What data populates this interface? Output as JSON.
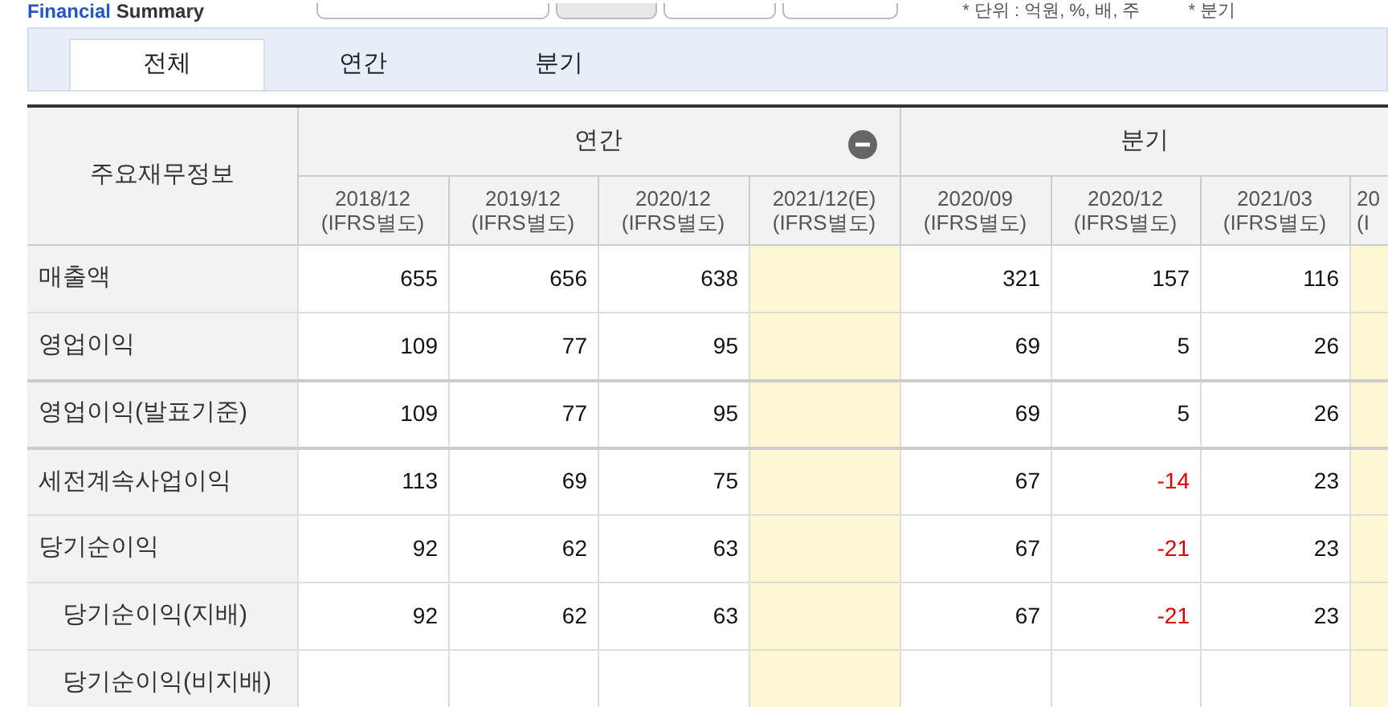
{
  "header": {
    "title_prefix": "Financial",
    "title": "Summary",
    "unit_note": "* 단위 : 억원, %, 배, 주",
    "note_2": "* 분기"
  },
  "tabs": [
    {
      "label": "전체",
      "selected": true
    },
    {
      "label": "연간",
      "selected": false
    },
    {
      "label": "분기",
      "selected": false
    }
  ],
  "table": {
    "corner": "주요재무정보",
    "groups": [
      {
        "label": "연간",
        "expanded": true,
        "columns": [
          {
            "period": "2018/12",
            "basis": "(IFRS별도)",
            "estimate": false
          },
          {
            "period": "2019/12",
            "basis": "(IFRS별도)",
            "estimate": false
          },
          {
            "period": "2020/12",
            "basis": "(IFRS별도)",
            "estimate": false
          },
          {
            "period": "2021/12(E)",
            "basis": "(IFRS별도)",
            "estimate": true
          }
        ]
      },
      {
        "label": "분기",
        "columns": [
          {
            "period": "2020/09",
            "basis": "(IFRS별도)",
            "estimate": false
          },
          {
            "period": "2020/12",
            "basis": "(IFRS별도)",
            "estimate": false
          },
          {
            "period": "2021/03",
            "basis": "(IFRS별도)",
            "estimate": false
          },
          {
            "period": "20",
            "basis": "(I",
            "estimate": true
          }
        ]
      }
    ],
    "rows": [
      {
        "label": "매출액",
        "cells": [
          {
            "text": "655",
            "negative": false
          },
          {
            "text": "656",
            "negative": false
          },
          {
            "text": "638",
            "negative": false
          },
          null,
          {
            "text": "321",
            "negative": false
          },
          {
            "text": "157",
            "negative": false
          },
          {
            "text": "116",
            "negative": false
          },
          null
        ]
      },
      {
        "label": "영업이익",
        "cells": [
          {
            "text": "109",
            "negative": false
          },
          {
            "text": "77",
            "negative": false
          },
          {
            "text": "95",
            "negative": false
          },
          null,
          {
            "text": "69",
            "negative": false
          },
          {
            "text": "5",
            "negative": false
          },
          {
            "text": "26",
            "negative": false
          },
          null
        ]
      },
      {
        "label": "영업이익(발표기준)",
        "cells": [
          {
            "text": "109",
            "negative": false
          },
          {
            "text": "77",
            "negative": false
          },
          {
            "text": "95",
            "negative": false
          },
          null,
          {
            "text": "69",
            "negative": false
          },
          {
            "text": "5",
            "negative": false
          },
          {
            "text": "26",
            "negative": false
          },
          null
        ]
      },
      {
        "label": "세전계속사업이익",
        "cells": [
          {
            "text": "113",
            "negative": false
          },
          {
            "text": "69",
            "negative": false
          },
          {
            "text": "75",
            "negative": false
          },
          null,
          {
            "text": "67",
            "negative": false
          },
          {
            "text": "-14",
            "negative": true
          },
          {
            "text": "23",
            "negative": false
          },
          null
        ]
      },
      {
        "label": "당기순이익",
        "cells": [
          {
            "text": "92",
            "negative": false
          },
          {
            "text": "62",
            "negative": false
          },
          {
            "text": "63",
            "negative": false
          },
          null,
          {
            "text": "67",
            "negative": false
          },
          {
            "text": "-21",
            "negative": true
          },
          {
            "text": "23",
            "negative": false
          },
          null
        ],
        "children": [
          {
            "label": "당기순이익(지배)",
            "cells": [
              {
                "text": "92",
                "negative": false
              },
              {
                "text": "62",
                "negative": false
              },
              {
                "text": "63",
                "negative": false
              },
              null,
              {
                "text": "67",
                "negative": false
              },
              {
                "text": "-21",
                "negative": true
              },
              {
                "text": "23",
                "negative": false
              },
              null
            ]
          },
          {
            "label": "당기순이익(비지배)",
            "cells": [
              null,
              null,
              null,
              null,
              null,
              null,
              null,
              null
            ]
          }
        ]
      }
    ]
  }
}
